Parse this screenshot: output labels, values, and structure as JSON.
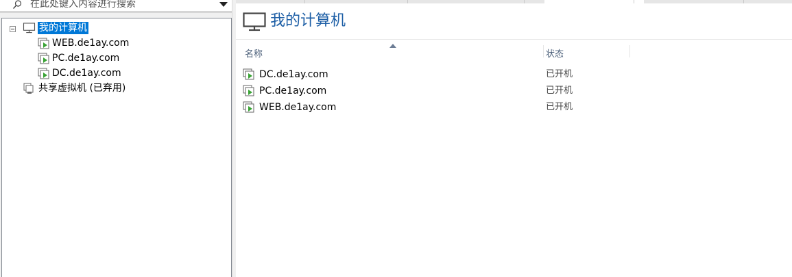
{
  "search": {
    "placeholder": "在此处键入内容进行搜索"
  },
  "tree": {
    "root": {
      "label": "我的计算机"
    },
    "children": [
      {
        "label": "WEB.de1ay.com"
      },
      {
        "label": "PC.de1ay.com"
      },
      {
        "label": "DC.de1ay.com"
      }
    ],
    "shared": {
      "label": "共享虚拟机 (已弃用)"
    }
  },
  "main": {
    "title": "我的计算机",
    "columns": {
      "name": "名称",
      "status": "状态"
    },
    "rows": [
      {
        "name": "DC.de1ay.com",
        "status": "已开机"
      },
      {
        "name": "PC.de1ay.com",
        "status": "已开机"
      },
      {
        "name": "WEB.de1ay.com",
        "status": "已开机"
      }
    ]
  },
  "icons": {
    "search": "search-icon",
    "dropdown": "chevron-down-icon",
    "computer": "monitor-icon",
    "vm": "vm-running-icon",
    "shared": "shared-vm-icon",
    "collapse": "tree-collapse-icon",
    "sort": "sort-ascending-icon"
  },
  "colors": {
    "accent": "#0078d7",
    "title": "#1e5fa6",
    "vm_play": "#3aa335"
  }
}
